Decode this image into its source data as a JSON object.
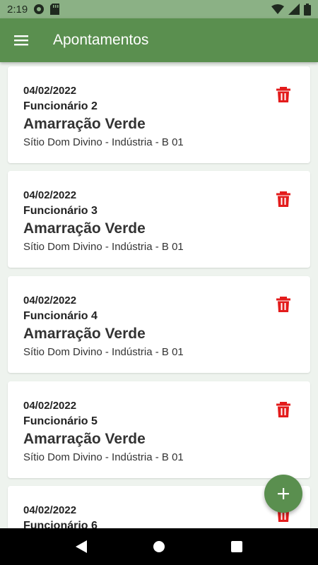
{
  "status_bar": {
    "time": "2:19",
    "icons": [
      "app-notification-icon",
      "sd-card-icon",
      "wifi-icon",
      "signal-icon",
      "battery-icon"
    ]
  },
  "app_bar": {
    "title": "Apontamentos",
    "menu_icon": "hamburger-menu-icon"
  },
  "records": [
    {
      "date": "04/02/2022",
      "employee": "Funcionário 2",
      "activity": "Amarração Verde",
      "location": "Sítio Dom Divino - Indústria - B 01"
    },
    {
      "date": "04/02/2022",
      "employee": "Funcionário 3",
      "activity": "Amarração Verde",
      "location": "Sítio Dom Divino - Indústria - B 01"
    },
    {
      "date": "04/02/2022",
      "employee": "Funcionário 4",
      "activity": "Amarração Verde",
      "location": "Sítio Dom Divino - Indústria - B 01"
    },
    {
      "date": "04/02/2022",
      "employee": "Funcionário 5",
      "activity": "Amarração Verde",
      "location": "Sítio Dom Divino - Indústria - B 01"
    },
    {
      "date": "04/02/2022",
      "employee": "Funcionário 6"
    }
  ],
  "delete_icon": "trash-icon",
  "fab_icon": "plus-icon",
  "colors": {
    "primary": "#5a8f4f",
    "status_bar": "#8bb185",
    "delete": "#e31c1c",
    "background": "#eef3ee"
  },
  "nav_bar": {
    "icons": [
      "back-icon",
      "home-icon",
      "recents-icon"
    ]
  }
}
